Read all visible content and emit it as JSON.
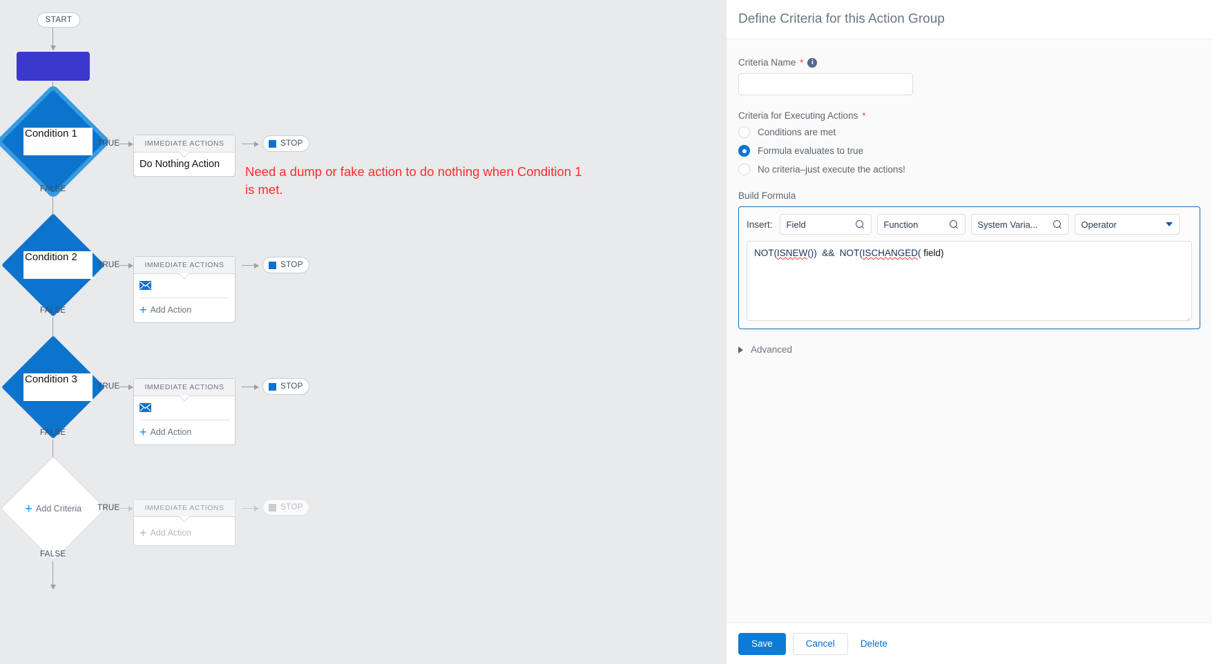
{
  "canvas": {
    "start_label": "START",
    "branch_true": "TRUE",
    "branch_false": "FALSE",
    "immediate_actions_header": "IMMEDIATE ACTIONS",
    "stop_label": "STOP",
    "add_action_label": "Add Action",
    "add_criteria_label": "Add Criteria",
    "mail_icon": "envelope-icon",
    "rows": [
      {
        "criteria_label": "Condition 1",
        "action_text": "Do Nothing Action",
        "has_mail_action": false,
        "has_add_action": false,
        "dimmed": false
      },
      {
        "criteria_label": "Condition 2",
        "action_text": "",
        "has_mail_action": true,
        "has_add_action": true,
        "dimmed": false
      },
      {
        "criteria_label": "Condition 3",
        "action_text": "",
        "has_mail_action": true,
        "has_add_action": true,
        "dimmed": false
      },
      {
        "criteria_label": "Add Criteria",
        "action_text": "",
        "has_mail_action": false,
        "has_add_action": true,
        "dimmed": true
      }
    ],
    "annotation": "Need a dump or fake action to do nothing when Condition 1 is met.",
    "annotation_color": "#ff2b2b",
    "node_color": "#3b38cc",
    "criteria_color": "#0d74cd"
  },
  "scrollbar": {
    "up_icon": "triangle-up-icon",
    "down_icon": "triangle-down-icon"
  },
  "panel": {
    "title": "Define Criteria for this Action Group",
    "criteria_name": {
      "label": "Criteria Name",
      "required_mark": "*",
      "info_icon": "info-icon",
      "value": "",
      "placeholder": ""
    },
    "criteria_for_executing": {
      "label": "Criteria for Executing Actions",
      "required_mark": "*",
      "options": [
        {
          "label": "Conditions are met",
          "selected": false
        },
        {
          "label": "Formula evaluates to true",
          "selected": true
        },
        {
          "label": "No criteria–just execute the actions!",
          "selected": false
        }
      ]
    },
    "build_formula": {
      "label": "Build Formula",
      "insert_label": "Insert:",
      "pickers": [
        {
          "label": "Field",
          "icon": "search-icon"
        },
        {
          "label": "Function",
          "icon": "search-icon"
        },
        {
          "label": "System Varia...",
          "icon": "search-icon"
        },
        {
          "label": "Operator",
          "icon": "chevron-down-icon"
        }
      ],
      "formula_parts": [
        {
          "text": "NOT(",
          "underline": false
        },
        {
          "text": "ISNEW",
          "underline": true
        },
        {
          "text": "())  &&  NOT(",
          "underline": false
        },
        {
          "text": "ISCHANGED",
          "underline": true
        },
        {
          "text": "(",
          "underline": false
        },
        {
          "text": " field)",
          "underline": false
        }
      ],
      "formula_value": "NOT(ISNEW())  &&  NOT(ISCHANGED( field)"
    },
    "advanced": {
      "label": "Advanced",
      "icon": "chevron-right-icon",
      "expanded": false
    },
    "footer": {
      "save_label": "Save",
      "cancel_label": "Cancel",
      "delete_label": "Delete"
    },
    "accent_color": "#0070d2"
  }
}
